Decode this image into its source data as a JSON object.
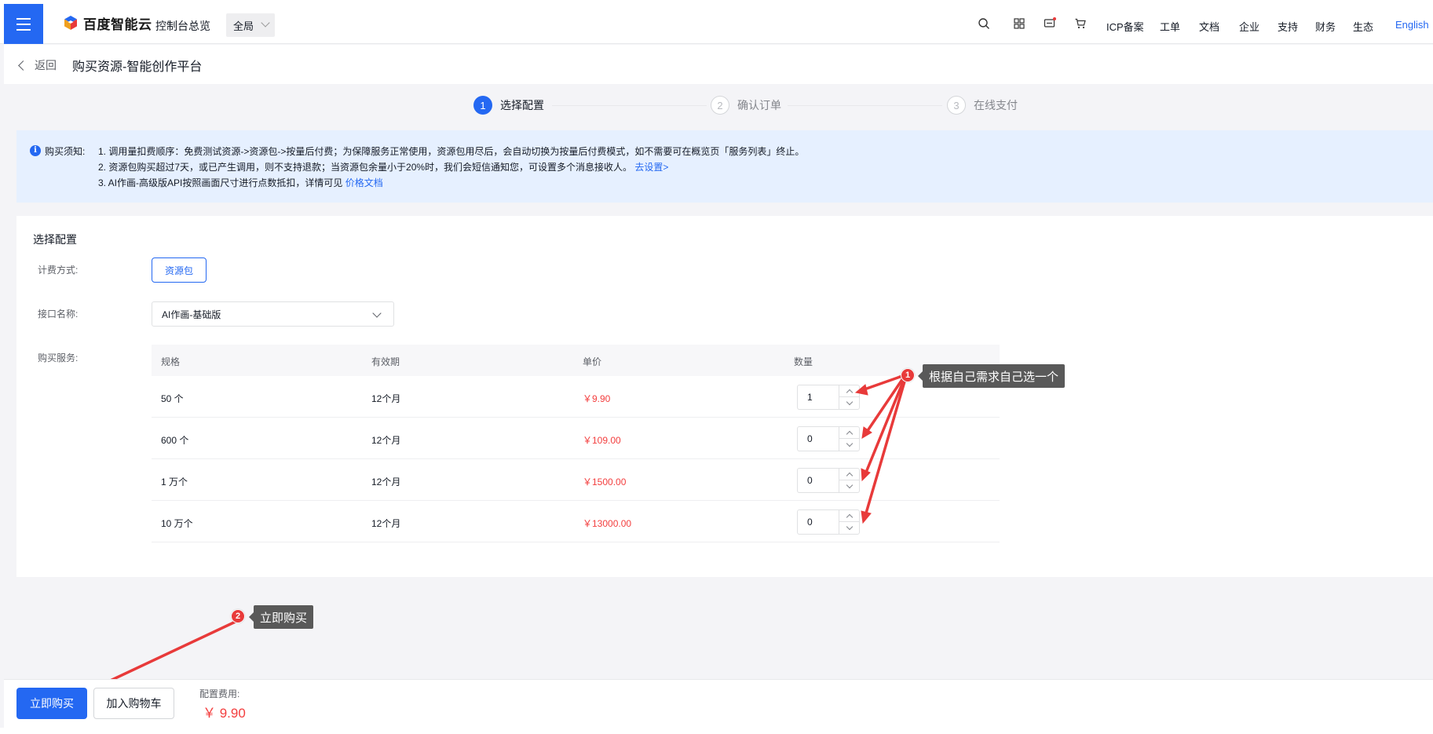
{
  "topnav": {
    "logo_text": "百度智能云",
    "console": "控制台总览",
    "region": "全局",
    "links": {
      "icp": "ICP备案",
      "ticket": "工单",
      "docs": "文档",
      "enterprise": "企业",
      "support": "支持",
      "finance": "财务",
      "ecosystem": "生态",
      "english": "English"
    }
  },
  "backbar": {
    "back": "返回",
    "title": "购买资源-智能创作平台"
  },
  "steps": [
    {
      "num": "1",
      "label": "选择配置"
    },
    {
      "num": "2",
      "label": "确认订单"
    },
    {
      "num": "3",
      "label": "在线支付"
    }
  ],
  "notice": {
    "title": "购买须知:",
    "line1": "1. 调用量扣费顺序：免费测试资源->资源包->按量后付费；为保障服务正常使用，资源包用尽后，会自动切换为按量后付费模式，如不需要可在概览页「服务列表」终止。",
    "line2": "2. 资源包购买超过7天，或已产生调用，则不支持退款；当资源包余量小于20%时，我们会短信通知您，可设置多个消息接收人。",
    "line2_link": "去设置>",
    "line3": "3. AI作画-高级版API按照画面尺寸进行点数抵扣，详情可见",
    "line3_link": "价格文档"
  },
  "config": {
    "title": "选择配置",
    "billing_label": "计费方式:",
    "billing_value": "资源包",
    "api_label": "接口名称:",
    "api_value": "AI作画-基础版",
    "service_label": "购买服务:",
    "table": {
      "headers": [
        "规格",
        "有效期",
        "单价",
        "数量"
      ],
      "rows": [
        {
          "spec": "50 个",
          "period": "12个月",
          "price": "￥9.90",
          "qty": "1"
        },
        {
          "spec": "600 个",
          "period": "12个月",
          "price": "￥109.00",
          "qty": "0"
        },
        {
          "spec": "1 万个",
          "period": "12个月",
          "price": "￥1500.00",
          "qty": "0"
        },
        {
          "spec": "10 万个",
          "period": "12个月",
          "price": "￥13000.00",
          "qty": "0"
        }
      ]
    }
  },
  "annotations": {
    "a1_num": "1",
    "a1_text": "根据自己需求自己选一个",
    "a2_num": "2",
    "a2_text": "立即购买",
    "color": "#e83a3a"
  },
  "bottom": {
    "buy": "立即购买",
    "cart": "加入购物车",
    "fee_label": "配置费用:",
    "fee_value": "￥ 9.90"
  },
  "colors": {
    "primary": "#2468f2",
    "price": "#f33e3e",
    "notice_bg": "#e6f0ff"
  }
}
